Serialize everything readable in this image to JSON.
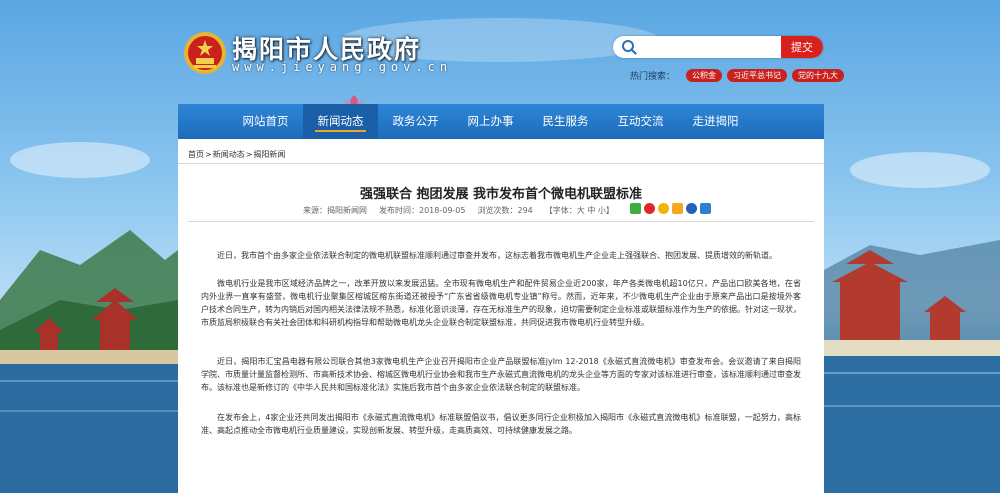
{
  "site": {
    "title": "揭阳市人民政府",
    "url": "www.jieyang.gov.cn"
  },
  "search": {
    "placeholder": "",
    "button_label": "提交",
    "hot_label": "热门搜索：",
    "hot_tags": [
      "公积金",
      "习近平总书记",
      "党的十九大"
    ]
  },
  "nav": {
    "items": [
      "网站首页",
      "新闻动态",
      "政务公开",
      "网上办事",
      "民生服务",
      "互动交流",
      "走进揭阳"
    ],
    "active_index": 1
  },
  "breadcrumb": [
    "首页",
    "新闻动态",
    "揭阳新闻"
  ],
  "breadcrumb_sep": ">",
  "article": {
    "title": "强强联合 抱团发展 我市发布首个微电机联盟标准",
    "source": "来源：揭阳新闻网",
    "date": "发布时间：2018-09-05",
    "views": "浏览次数：294",
    "font_size": "【字体：大 中 小】",
    "paragraphs": [
      "近日，我市首个由多家企业依法联合制定的微电机联盟标准顺利通过审查并发布，这标志着我市微电机生产企业走上强强联合、抱团发展、提质增效的新轨道。",
      "微电机行业是我市区域经济品牌之一，改革开放以来发展迅猛。全市现有微电机生产和配件贸易企业近200家，年产各类微电机超10亿只，产品出口欧美各地，在省内外业界一直享有盛誉，微电机行业聚集区榕城区榕东街道还被授予“广东省省级微电机专业镇”称号。然而，近年来，不少微电机生产企业由于原来产品出口是按境外客户技术合同生产，转为内销后对国内相关法律法规不熟悉，标准化意识淡薄，存在无标准生产的现象，迫切需要制定企业标准或联盟标准作为生产的依据。针对这一现状，市质监局积极联合有关社会团体和科研机构指导和帮助微电机龙头企业联合制定联盟标准，共同促进我市微电机行业转型升级。",
      "近日，揭阳市汇宝昌电器有限公司联合其他3家微电机生产企业召开揭阳市企业产品联盟标准jylm 12-2018《永磁式直流微电机》审查发布会。会议邀请了来自揭阳学院、市质量计量监督检测所、市高新技术协会、榕城区微电机行业协会和我市生产永磁式直流微电机的龙头企业等方面的专家对该标准进行审查，该标准顺利通过审查发布。该标准也是新修订的《中华人民共和国标准化法》实施后我市首个由多家企业依法联合制定的联盟标准。",
      "在发布会上，4家企业还共同发出揭阳市《永磁式直流微电机》标准联盟倡议书，倡议更多同行企业积极加入揭阳市《永磁式直流微电机》标准联盟，一起努力，高标准、高起点推动全市微电机行业质量建设，实现创新发展、转型升级，走高质高效、可持续健康发展之路。"
    ]
  },
  "colors": {
    "nav_blue": "#1b6bbb",
    "accent_red": "#d9211c"
  }
}
